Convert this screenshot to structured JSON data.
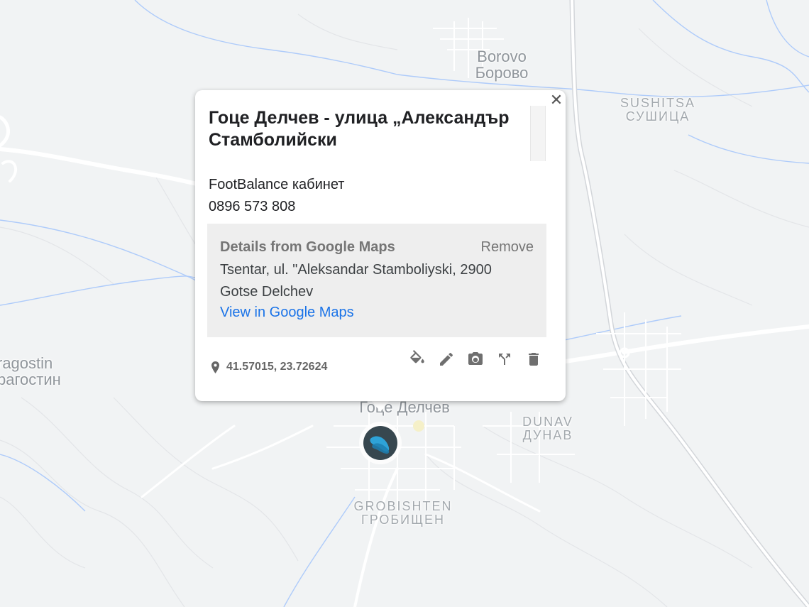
{
  "map": {
    "places": [
      {
        "latin": "Borovo",
        "cyrillic": "Борово"
      },
      {
        "latin": "SUSHITSA",
        "cyrillic": "СУШИЦА"
      },
      {
        "latin": "ragostin",
        "cyrillic": "рагостин"
      },
      {
        "latin": "",
        "cyrillic": "Гоце Делчев"
      },
      {
        "latin": "DUNAV",
        "cyrillic": "ДУНАВ"
      },
      {
        "latin": "GROBISHTEN",
        "cyrillic": "ГРОБИЩЕН"
      }
    ],
    "colors": {
      "land": "#f1f3f4",
      "road": "#ffffff",
      "water": "#aecbfa",
      "contour": "#dadce0"
    }
  },
  "popup": {
    "close_icon": "close-icon",
    "title": "Гоце Делчев - улица „Александър Стамболийски",
    "description_lines": [
      "FootBalance кабинет",
      "0896 573 808"
    ],
    "details": {
      "heading": "Details from Google Maps",
      "remove_label": "Remove",
      "address": "Tsentar, ul. \"Aleksandar Stamboliyski, 2900 Gotse Delchev",
      "link_label": "View in Google Maps",
      "link_color": "#1a73e8"
    },
    "coordinates": "41.57015, 23.72624",
    "toolbar": [
      {
        "name": "paint-bucket-icon",
        "label": "Style"
      },
      {
        "name": "pencil-icon",
        "label": "Edit"
      },
      {
        "name": "camera-icon",
        "label": "Add image"
      },
      {
        "name": "directions-icon",
        "label": "Directions"
      },
      {
        "name": "trash-icon",
        "label": "Delete"
      }
    ]
  },
  "marker": {
    "icon": "footprint-icon",
    "color": "#37474f",
    "accent": "#2ea3d8"
  }
}
